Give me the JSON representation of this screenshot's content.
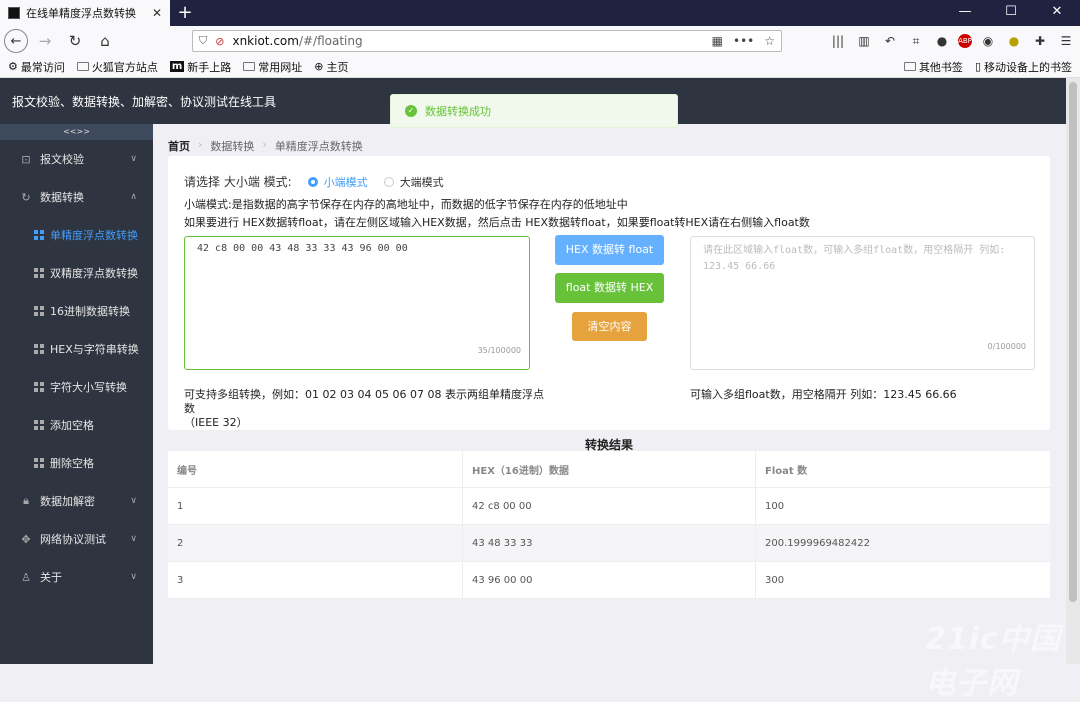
{
  "browser": {
    "tab_title": "在线单精度浮点数转换",
    "url_domain": "xnkiot.com",
    "url_path": "/#/floating",
    "bookmarks": [
      "最常访问",
      "火狐官方站点",
      "新手上路",
      "常用网址",
      "主页"
    ],
    "bookmarks_right": [
      "其他书签",
      "移动设备上的书签"
    ]
  },
  "app": {
    "title": "报文校验、数据转换、加解密、协议测试在线工具",
    "collapse_label": "<<>>"
  },
  "sidebar": {
    "items": [
      {
        "label": "报文校验",
        "type": "group"
      },
      {
        "label": "数据转换",
        "type": "group"
      },
      {
        "label": "单精度浮点数转换",
        "type": "sub",
        "active": true
      },
      {
        "label": "双精度浮点数转换",
        "type": "sub"
      },
      {
        "label": "16进制数据转换",
        "type": "sub"
      },
      {
        "label": "HEX与字符串转换",
        "type": "sub"
      },
      {
        "label": "字符大小写转换",
        "type": "sub"
      },
      {
        "label": "添加空格",
        "type": "sub"
      },
      {
        "label": "删除空格",
        "type": "sub"
      },
      {
        "label": "数据加解密",
        "type": "group"
      },
      {
        "label": "网络协议测试",
        "type": "group"
      },
      {
        "label": "关于",
        "type": "group"
      }
    ]
  },
  "toast": {
    "message": "数据转换成功"
  },
  "breadcrumb": {
    "home": "首页",
    "level1": "数据转换",
    "level2": "单精度浮点数转换"
  },
  "form": {
    "mode_label": "请选择 大小端 模式:",
    "mode_little": "小端模式",
    "mode_big": "大端模式",
    "desc1": "小端模式:是指数据的高字节保存在内存的高地址中，而数据的低字节保存在内存的低地址中",
    "desc2": "如果要进行 HEX数据转float，请在左侧区域输入HEX数据，然后点击 HEX数据转float，如果要float转HEX请在右侧输入float数",
    "hex_input": "42 c8 00 00 43 48 33 33 43 96 00 00",
    "hex_count": "35/100000",
    "float_placeholder": "请在此区域输入float数，可输入多组float数，用空格隔开 列如: 123.45 66.66",
    "float_count": "0/100000",
    "btn_hex_to_float": "HEX 数据转 float",
    "btn_float_to_hex": "float 数据转 HEX",
    "btn_clear": "清空内容",
    "note_left": "可支持多组转换，例如：01 02 03 04 05 06 07 08 表示两组单精度浮点数",
    "note_left_2": "（IEEE 32）",
    "note_right": "可输入多组float数，用空格隔开 列如：123.45 66.66"
  },
  "results": {
    "title": "转换结果",
    "headers": [
      "编号",
      "HEX（16进制）数据",
      "Float 数"
    ],
    "rows": [
      [
        "1",
        "42 c8 00 00",
        "100"
      ],
      [
        "2",
        "43 48 33 33",
        "200.1999969482422"
      ],
      [
        "3",
        "43 96 00 00",
        "300"
      ]
    ]
  },
  "watermark": "21ic中国电子网"
}
